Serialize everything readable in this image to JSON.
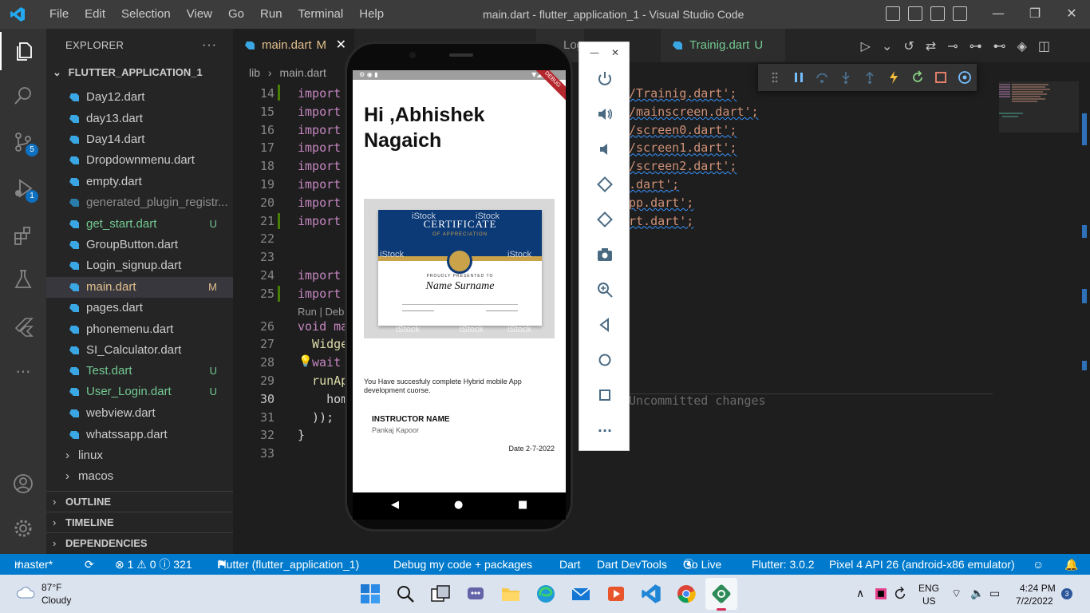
{
  "titlebar": {
    "menu": [
      "File",
      "Edit",
      "Selection",
      "View",
      "Go",
      "Run",
      "Terminal",
      "Help"
    ],
    "window_title": "main.dart - flutter_application_1 - Visual Studio Code",
    "controls": [
      "—",
      "❐",
      "✕"
    ]
  },
  "activity": {
    "scm_badge": "5",
    "debug_badge": "1",
    "more": "···"
  },
  "explorer": {
    "title": "EXPLORER",
    "more": "···",
    "project": "FLUTTER_APPLICATION_1",
    "files": [
      {
        "name": "Day12.dart",
        "badge": ""
      },
      {
        "name": "day13.dart",
        "badge": ""
      },
      {
        "name": "Day14.dart",
        "badge": ""
      },
      {
        "name": "Dropdownmenu.dart",
        "badge": ""
      },
      {
        "name": "empty.dart",
        "badge": ""
      },
      {
        "name": "generated_plugin_registr...",
        "badge": ""
      },
      {
        "name": "get_start.dart",
        "badge": "U"
      },
      {
        "name": "GroupButton.dart",
        "badge": ""
      },
      {
        "name": "Login_signup.dart",
        "badge": ""
      },
      {
        "name": "main.dart",
        "badge": "M"
      },
      {
        "name": "pages.dart",
        "badge": ""
      },
      {
        "name": "phonemenu.dart",
        "badge": ""
      },
      {
        "name": "SI_Calculator.dart",
        "badge": ""
      },
      {
        "name": "Test.dart",
        "badge": "U"
      },
      {
        "name": "User_Login.dart",
        "badge": "U"
      },
      {
        "name": "webview.dart",
        "badge": ""
      },
      {
        "name": "whatssapp.dart",
        "badge": ""
      }
    ],
    "folders": [
      "linux",
      "macos"
    ],
    "sections": [
      "OUTLINE",
      "TIMELINE",
      "DEPENDENCIES"
    ]
  },
  "editor": {
    "tabs": [
      {
        "name": "main.dart",
        "badge": "M"
      },
      {
        "name": "Log",
        "badge": ""
      },
      {
        "name": "Trainig.dart",
        "badge": "U"
      }
    ],
    "breadcrumb": [
      "lib",
      "main.dart"
    ],
    "line_numbers": [
      "14",
      "15",
      "16",
      "17",
      "18",
      "19",
      "20",
      "21",
      "22",
      "23",
      "24",
      "25",
      "26",
      "27",
      "28",
      "29",
      "30",
      "31",
      "32",
      "33"
    ],
    "code_left": [
      "import",
      "import",
      "import",
      "import",
      "import",
      "import",
      "import",
      "import",
      "",
      "",
      "import",
      "import",
      "void ma",
      "  Widge",
      "wait",
      "  runAp",
      "    hom",
      "  ));",
      "}",
      ""
    ],
    "code_right": [
      "/Trainig.dart';",
      "/mainscreen.dart';",
      "/screen0.dart';",
      "/screen1.dart';",
      "/screen2.dart';",
      ".dart';",
      "pp.dart';",
      "rt.dart';"
    ],
    "codelens": "Run | Deb",
    "ghost_text": "Uncommitted changes"
  },
  "emulator": {
    "greeting": "Hi ,Abhishek Nagaich",
    "debug_ribbon": "DEBUG",
    "certificate": {
      "title": "CERTIFICATE",
      "subtitle": "OF APPRECIATION",
      "presented": "PROUDLY PRESENTED TO",
      "name": "Name Surname",
      "watermark": "iStock"
    },
    "message": "You Have succesfuly complete  Hybrid mobile App development  cuorse.",
    "instructor_label": "INSTRUCTOR NAME",
    "instructor_name": "Pankaj Kapoor",
    "date": "Date  2-7-2022",
    "nav": [
      "◀",
      "●",
      "■"
    ],
    "toolbar_top": [
      "—",
      "✕"
    ],
    "toolbar_more": "···"
  },
  "statusbar": {
    "branch": "master*",
    "sync": "⟳",
    "problems": "⊗ 1 ⚠ 0 ⓘ 321",
    "flutter": "Flutter (flutter_application_1)",
    "debug_mode": "Debug my code + packages",
    "dart": "Dart",
    "devtools": "Dart DevTools",
    "golive": "Go Live",
    "flutter_version": "Flutter: 3.0.2",
    "device": "Pixel 4 API 26 (android-x86 emulator)"
  },
  "taskbar": {
    "temperature": "87°F",
    "weather": "Cloudy",
    "lang": "ENG",
    "region": "US",
    "time": "4:24 PM",
    "date": "7/2/2022",
    "notifications": "3",
    "chevron": "∧"
  },
  "colors": {
    "accent": "#007acc",
    "modified": "#e2c08d",
    "untracked": "#73c991"
  }
}
